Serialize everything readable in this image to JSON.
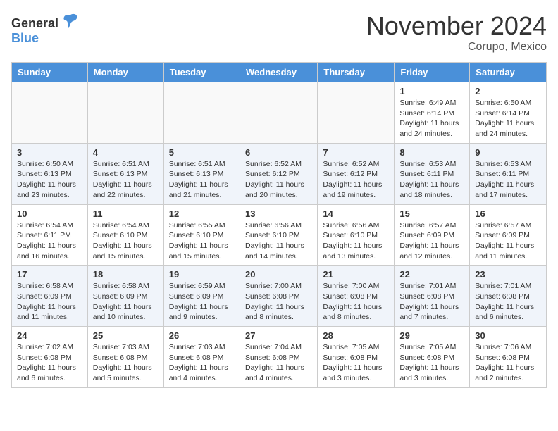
{
  "header": {
    "logo_general": "General",
    "logo_blue": "Blue",
    "month_title": "November 2024",
    "location": "Corupo, Mexico"
  },
  "weekdays": [
    "Sunday",
    "Monday",
    "Tuesday",
    "Wednesday",
    "Thursday",
    "Friday",
    "Saturday"
  ],
  "weeks": [
    [
      {
        "day": "",
        "info": ""
      },
      {
        "day": "",
        "info": ""
      },
      {
        "day": "",
        "info": ""
      },
      {
        "day": "",
        "info": ""
      },
      {
        "day": "",
        "info": ""
      },
      {
        "day": "1",
        "info": "Sunrise: 6:49 AM\nSunset: 6:14 PM\nDaylight: 11 hours and 24 minutes."
      },
      {
        "day": "2",
        "info": "Sunrise: 6:50 AM\nSunset: 6:14 PM\nDaylight: 11 hours and 24 minutes."
      }
    ],
    [
      {
        "day": "3",
        "info": "Sunrise: 6:50 AM\nSunset: 6:13 PM\nDaylight: 11 hours and 23 minutes."
      },
      {
        "day": "4",
        "info": "Sunrise: 6:51 AM\nSunset: 6:13 PM\nDaylight: 11 hours and 22 minutes."
      },
      {
        "day": "5",
        "info": "Sunrise: 6:51 AM\nSunset: 6:13 PM\nDaylight: 11 hours and 21 minutes."
      },
      {
        "day": "6",
        "info": "Sunrise: 6:52 AM\nSunset: 6:12 PM\nDaylight: 11 hours and 20 minutes."
      },
      {
        "day": "7",
        "info": "Sunrise: 6:52 AM\nSunset: 6:12 PM\nDaylight: 11 hours and 19 minutes."
      },
      {
        "day": "8",
        "info": "Sunrise: 6:53 AM\nSunset: 6:11 PM\nDaylight: 11 hours and 18 minutes."
      },
      {
        "day": "9",
        "info": "Sunrise: 6:53 AM\nSunset: 6:11 PM\nDaylight: 11 hours and 17 minutes."
      }
    ],
    [
      {
        "day": "10",
        "info": "Sunrise: 6:54 AM\nSunset: 6:11 PM\nDaylight: 11 hours and 16 minutes."
      },
      {
        "day": "11",
        "info": "Sunrise: 6:54 AM\nSunset: 6:10 PM\nDaylight: 11 hours and 15 minutes."
      },
      {
        "day": "12",
        "info": "Sunrise: 6:55 AM\nSunset: 6:10 PM\nDaylight: 11 hours and 15 minutes."
      },
      {
        "day": "13",
        "info": "Sunrise: 6:56 AM\nSunset: 6:10 PM\nDaylight: 11 hours and 14 minutes."
      },
      {
        "day": "14",
        "info": "Sunrise: 6:56 AM\nSunset: 6:10 PM\nDaylight: 11 hours and 13 minutes."
      },
      {
        "day": "15",
        "info": "Sunrise: 6:57 AM\nSunset: 6:09 PM\nDaylight: 11 hours and 12 minutes."
      },
      {
        "day": "16",
        "info": "Sunrise: 6:57 AM\nSunset: 6:09 PM\nDaylight: 11 hours and 11 minutes."
      }
    ],
    [
      {
        "day": "17",
        "info": "Sunrise: 6:58 AM\nSunset: 6:09 PM\nDaylight: 11 hours and 11 minutes."
      },
      {
        "day": "18",
        "info": "Sunrise: 6:58 AM\nSunset: 6:09 PM\nDaylight: 11 hours and 10 minutes."
      },
      {
        "day": "19",
        "info": "Sunrise: 6:59 AM\nSunset: 6:09 PM\nDaylight: 11 hours and 9 minutes."
      },
      {
        "day": "20",
        "info": "Sunrise: 7:00 AM\nSunset: 6:08 PM\nDaylight: 11 hours and 8 minutes."
      },
      {
        "day": "21",
        "info": "Sunrise: 7:00 AM\nSunset: 6:08 PM\nDaylight: 11 hours and 8 minutes."
      },
      {
        "day": "22",
        "info": "Sunrise: 7:01 AM\nSunset: 6:08 PM\nDaylight: 11 hours and 7 minutes."
      },
      {
        "day": "23",
        "info": "Sunrise: 7:01 AM\nSunset: 6:08 PM\nDaylight: 11 hours and 6 minutes."
      }
    ],
    [
      {
        "day": "24",
        "info": "Sunrise: 7:02 AM\nSunset: 6:08 PM\nDaylight: 11 hours and 6 minutes."
      },
      {
        "day": "25",
        "info": "Sunrise: 7:03 AM\nSunset: 6:08 PM\nDaylight: 11 hours and 5 minutes."
      },
      {
        "day": "26",
        "info": "Sunrise: 7:03 AM\nSunset: 6:08 PM\nDaylight: 11 hours and 4 minutes."
      },
      {
        "day": "27",
        "info": "Sunrise: 7:04 AM\nSunset: 6:08 PM\nDaylight: 11 hours and 4 minutes."
      },
      {
        "day": "28",
        "info": "Sunrise: 7:05 AM\nSunset: 6:08 PM\nDaylight: 11 hours and 3 minutes."
      },
      {
        "day": "29",
        "info": "Sunrise: 7:05 AM\nSunset: 6:08 PM\nDaylight: 11 hours and 3 minutes."
      },
      {
        "day": "30",
        "info": "Sunrise: 7:06 AM\nSunset: 6:08 PM\nDaylight: 11 hours and 2 minutes."
      }
    ]
  ]
}
